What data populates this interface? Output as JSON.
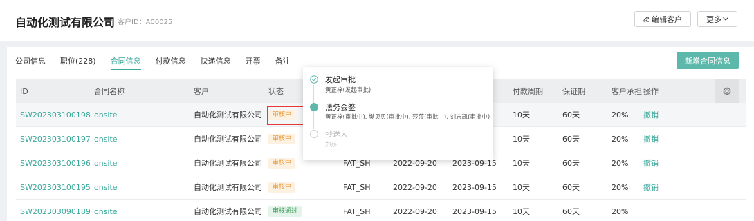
{
  "header": {
    "company_name": "自动化测试有限公司",
    "customer_id": "客户ID：A00025",
    "edit_button": "编辑客户",
    "more_button": "更多"
  },
  "tabs": [
    {
      "label": "公司信息",
      "active": false
    },
    {
      "label": "职位(228)",
      "active": false
    },
    {
      "label": "合同信息",
      "active": true
    },
    {
      "label": "付款信息",
      "active": false
    },
    {
      "label": "快递信息",
      "active": false
    },
    {
      "label": "开票",
      "active": false
    },
    {
      "label": "备注",
      "active": false
    }
  ],
  "new_contract_button": "新增合同信息",
  "table": {
    "headers": {
      "id": "ID",
      "name": "合同名称",
      "customer": "客户",
      "status": "状态",
      "cycle": "付款周期",
      "warranty": "保证期",
      "customer_share": "客户承担",
      "action": "操作"
    },
    "rows": [
      {
        "id": "SW202303100198",
        "name": "onsite",
        "customer": "自动化测试有限公司",
        "status": "审核中",
        "status_type": "pending",
        "code": "",
        "start": "",
        "end": "",
        "cycle": "10天",
        "warranty": "60天",
        "pct": "20%",
        "action": "撤销"
      },
      {
        "id": "SW202303100197",
        "name": "onsite",
        "customer": "自动化测试有限公司",
        "status": "审核中",
        "status_type": "pending",
        "code": "",
        "start": "",
        "end": "",
        "cycle": "10天",
        "warranty": "60天",
        "pct": "20%",
        "action": "撤销"
      },
      {
        "id": "SW202303100196",
        "name": "onsite",
        "customer": "自动化测试有限公司",
        "status": "审核中",
        "status_type": "pending",
        "code": "FAT_SH",
        "start": "2022-09-20",
        "end": "2023-09-15",
        "cycle": "10天",
        "warranty": "60天",
        "pct": "20%",
        "action": "撤销"
      },
      {
        "id": "SW202303100195",
        "name": "onsite",
        "customer": "自动化测试有限公司",
        "status": "审核中",
        "status_type": "pending",
        "code": "FAT_SH",
        "start": "2022-09-20",
        "end": "2023-09-15",
        "cycle": "10天",
        "warranty": "60天",
        "pct": "20%",
        "action": "撤销"
      },
      {
        "id": "SW202303090189",
        "name": "onsite",
        "customer": "自动化测试有限公司",
        "status": "审核通过",
        "status_type": "pass",
        "code": "FAT_SH",
        "start": "2022-09-20",
        "end": "2023-09-15",
        "cycle": "10天",
        "warranty": "60天",
        "pct": "20%",
        "action": ""
      }
    ]
  },
  "approval_popover": {
    "steps": [
      {
        "title": "发起审批",
        "desc": "黄正梓(发起审批)",
        "state": "done"
      },
      {
        "title": "法务会签",
        "desc": "黄正梓(审批中), 樊贝贝(审批中), 莎莎(审批中), 刘志凯(审批中)",
        "state": "current"
      },
      {
        "title": "抄送人",
        "desc": "郑莎",
        "state": "disabled"
      }
    ]
  },
  "colors": {
    "accent": "#3aa89b",
    "primary_button": "#5cb8aa",
    "pending": "#e79a3a",
    "pass": "#3a9b5b",
    "highlight_box": "#e53935"
  }
}
